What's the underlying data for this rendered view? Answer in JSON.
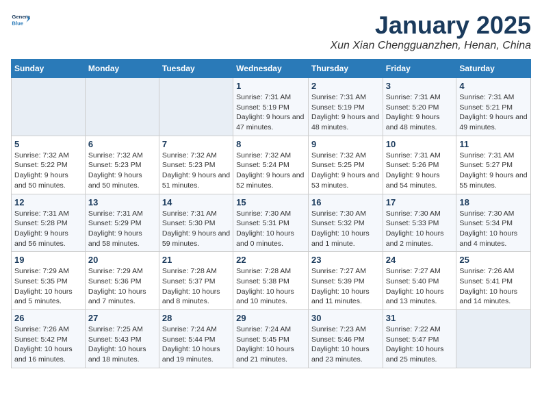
{
  "logo": {
    "general": "General",
    "blue": "Blue"
  },
  "title": "January 2025",
  "location": "Xun Xian Chengguanzhen, Henan, China",
  "headers": [
    "Sunday",
    "Monday",
    "Tuesday",
    "Wednesday",
    "Thursday",
    "Friday",
    "Saturday"
  ],
  "weeks": [
    [
      {
        "day": "",
        "info": ""
      },
      {
        "day": "",
        "info": ""
      },
      {
        "day": "",
        "info": ""
      },
      {
        "day": "1",
        "info": "Sunrise: 7:31 AM\nSunset: 5:19 PM\nDaylight: 9 hours and 47 minutes."
      },
      {
        "day": "2",
        "info": "Sunrise: 7:31 AM\nSunset: 5:19 PM\nDaylight: 9 hours and 48 minutes."
      },
      {
        "day": "3",
        "info": "Sunrise: 7:31 AM\nSunset: 5:20 PM\nDaylight: 9 hours and 48 minutes."
      },
      {
        "day": "4",
        "info": "Sunrise: 7:31 AM\nSunset: 5:21 PM\nDaylight: 9 hours and 49 minutes."
      }
    ],
    [
      {
        "day": "5",
        "info": "Sunrise: 7:32 AM\nSunset: 5:22 PM\nDaylight: 9 hours and 50 minutes."
      },
      {
        "day": "6",
        "info": "Sunrise: 7:32 AM\nSunset: 5:23 PM\nDaylight: 9 hours and 50 minutes."
      },
      {
        "day": "7",
        "info": "Sunrise: 7:32 AM\nSunset: 5:23 PM\nDaylight: 9 hours and 51 minutes."
      },
      {
        "day": "8",
        "info": "Sunrise: 7:32 AM\nSunset: 5:24 PM\nDaylight: 9 hours and 52 minutes."
      },
      {
        "day": "9",
        "info": "Sunrise: 7:32 AM\nSunset: 5:25 PM\nDaylight: 9 hours and 53 minutes."
      },
      {
        "day": "10",
        "info": "Sunrise: 7:31 AM\nSunset: 5:26 PM\nDaylight: 9 hours and 54 minutes."
      },
      {
        "day": "11",
        "info": "Sunrise: 7:31 AM\nSunset: 5:27 PM\nDaylight: 9 hours and 55 minutes."
      }
    ],
    [
      {
        "day": "12",
        "info": "Sunrise: 7:31 AM\nSunset: 5:28 PM\nDaylight: 9 hours and 56 minutes."
      },
      {
        "day": "13",
        "info": "Sunrise: 7:31 AM\nSunset: 5:29 PM\nDaylight: 9 hours and 58 minutes."
      },
      {
        "day": "14",
        "info": "Sunrise: 7:31 AM\nSunset: 5:30 PM\nDaylight: 9 hours and 59 minutes."
      },
      {
        "day": "15",
        "info": "Sunrise: 7:30 AM\nSunset: 5:31 PM\nDaylight: 10 hours and 0 minutes."
      },
      {
        "day": "16",
        "info": "Sunrise: 7:30 AM\nSunset: 5:32 PM\nDaylight: 10 hours and 1 minute."
      },
      {
        "day": "17",
        "info": "Sunrise: 7:30 AM\nSunset: 5:33 PM\nDaylight: 10 hours and 2 minutes."
      },
      {
        "day": "18",
        "info": "Sunrise: 7:30 AM\nSunset: 5:34 PM\nDaylight: 10 hours and 4 minutes."
      }
    ],
    [
      {
        "day": "19",
        "info": "Sunrise: 7:29 AM\nSunset: 5:35 PM\nDaylight: 10 hours and 5 minutes."
      },
      {
        "day": "20",
        "info": "Sunrise: 7:29 AM\nSunset: 5:36 PM\nDaylight: 10 hours and 7 minutes."
      },
      {
        "day": "21",
        "info": "Sunrise: 7:28 AM\nSunset: 5:37 PM\nDaylight: 10 hours and 8 minutes."
      },
      {
        "day": "22",
        "info": "Sunrise: 7:28 AM\nSunset: 5:38 PM\nDaylight: 10 hours and 10 minutes."
      },
      {
        "day": "23",
        "info": "Sunrise: 7:27 AM\nSunset: 5:39 PM\nDaylight: 10 hours and 11 minutes."
      },
      {
        "day": "24",
        "info": "Sunrise: 7:27 AM\nSunset: 5:40 PM\nDaylight: 10 hours and 13 minutes."
      },
      {
        "day": "25",
        "info": "Sunrise: 7:26 AM\nSunset: 5:41 PM\nDaylight: 10 hours and 14 minutes."
      }
    ],
    [
      {
        "day": "26",
        "info": "Sunrise: 7:26 AM\nSunset: 5:42 PM\nDaylight: 10 hours and 16 minutes."
      },
      {
        "day": "27",
        "info": "Sunrise: 7:25 AM\nSunset: 5:43 PM\nDaylight: 10 hours and 18 minutes."
      },
      {
        "day": "28",
        "info": "Sunrise: 7:24 AM\nSunset: 5:44 PM\nDaylight: 10 hours and 19 minutes."
      },
      {
        "day": "29",
        "info": "Sunrise: 7:24 AM\nSunset: 5:45 PM\nDaylight: 10 hours and 21 minutes."
      },
      {
        "day": "30",
        "info": "Sunrise: 7:23 AM\nSunset: 5:46 PM\nDaylight: 10 hours and 23 minutes."
      },
      {
        "day": "31",
        "info": "Sunrise: 7:22 AM\nSunset: 5:47 PM\nDaylight: 10 hours and 25 minutes."
      },
      {
        "day": "",
        "info": ""
      }
    ]
  ]
}
